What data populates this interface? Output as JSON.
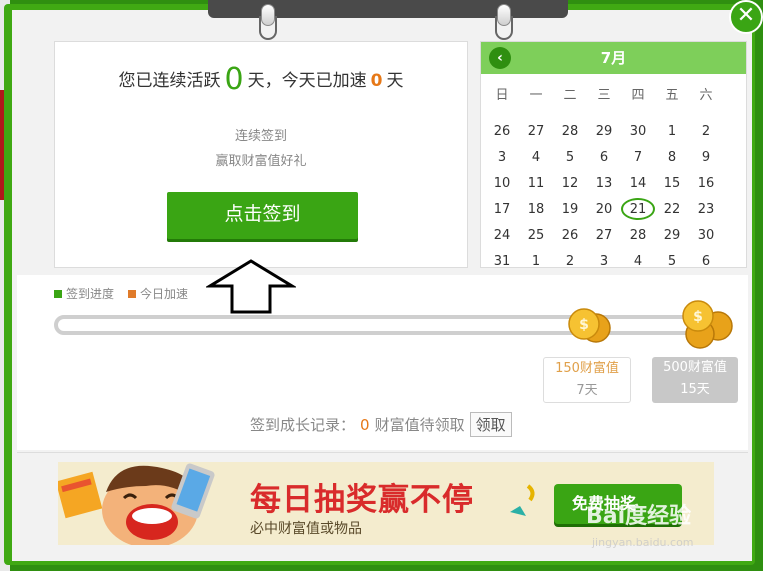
{
  "signin": {
    "stats_prefix": "您已连续活跃",
    "days": "0",
    "stats_mid": "天，今天已加速",
    "speedup": "0",
    "stats_suffix": "天",
    "promo_line1": "连续签到",
    "promo_line2": "赢取财富值好礼",
    "button": "点击签到"
  },
  "calendar": {
    "month": "7月",
    "weekdays": [
      "日",
      "一",
      "二",
      "三",
      "四",
      "五",
      "六"
    ],
    "weeks": [
      [
        "26",
        "27",
        "28",
        "29",
        "30",
        "1",
        "2"
      ],
      [
        "3",
        "4",
        "5",
        "6",
        "7",
        "8",
        "9"
      ],
      [
        "10",
        "11",
        "12",
        "13",
        "14",
        "15",
        "16"
      ],
      [
        "17",
        "18",
        "19",
        "20",
        "21",
        "22",
        "23"
      ],
      [
        "24",
        "25",
        "26",
        "27",
        "28",
        "29",
        "30"
      ],
      [
        "31",
        "1",
        "2",
        "3",
        "4",
        "5",
        "6"
      ]
    ],
    "today": "21"
  },
  "legend": {
    "progress": "签到进度",
    "speedup": "今日加速"
  },
  "rewards": [
    {
      "value": "150财富值",
      "days": "7天"
    },
    {
      "value": "500财富值",
      "days": "15天"
    }
  ],
  "growth": {
    "label": "签到成长记录：",
    "count": "0",
    "suffix": "财富值待领取",
    "claim": "领取"
  },
  "banner": {
    "title": "每日抽奖赢不停",
    "subtitle": "必中财富值或物品",
    "button": "免费抽奖"
  },
  "watermark": {
    "logo": "Bai度经验",
    "url": "jingyan.baidu.com"
  },
  "colors": {
    "green": "#3aa514",
    "orange": "#e67817",
    "legend_orange": "#e07b2a",
    "red_title": "#d92b2b"
  },
  "close_icon": "close-icon",
  "progress": {
    "days_completed": 0
  }
}
